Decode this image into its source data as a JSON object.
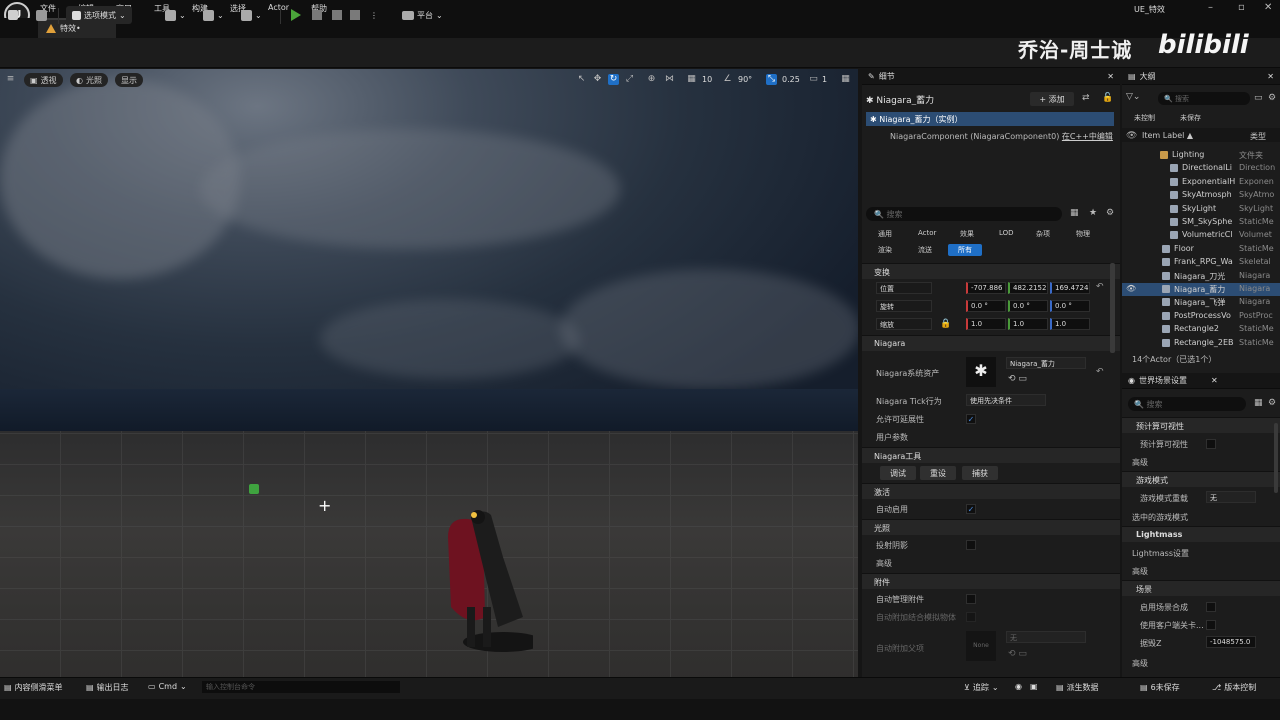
{
  "menu": {
    "items": [
      "文件",
      "编辑",
      "窗口",
      "工具",
      "构建",
      "选择",
      "Actor",
      "帮助"
    ],
    "window_title": "UE_特效"
  },
  "tab": {
    "label": "特效•"
  },
  "toolbar": {
    "mode": "选项模式",
    "platform": "平台"
  },
  "watermark": {
    "author": "乔治-周士诚",
    "site": "bilibili"
  },
  "viewport": {
    "perspective": "透视",
    "lit": "光照",
    "show": "显示",
    "grid_size": "10",
    "angle": "90°",
    "scale": "0.25",
    "camera_speed": "1"
  },
  "details": {
    "tab": "细节",
    "actor": "Niagara_蓄力",
    "add": "+ 添加",
    "instance": "Niagara_蓄力（实例）",
    "component": "NiagaraComponent (NiagaraComponent0)",
    "component_link": "在C++中编辑",
    "search_placeholder": "搜索",
    "cats_row1": [
      "通用",
      "Actor",
      "效果",
      "LOD",
      "杂项",
      "物理"
    ],
    "cats_row2": [
      "渲染",
      "流送",
      "所有"
    ],
    "sections": {
      "transform": "变换",
      "niagara": "Niagara",
      "tools": "Niagara工具",
      "activation": "激活",
      "lighting": "光照",
      "attachment": "附件"
    },
    "location": {
      "label": "位置",
      "x": "-707.886",
      "y": "482.2152",
      "z": "169.4724"
    },
    "rotation": {
      "label": "旋转",
      "x": "0.0 °",
      "y": "0.0 °",
      "z": "0.0 °"
    },
    "scale": {
      "label": "缩放",
      "x": "1.0",
      "y": "1.0",
      "z": "1.0"
    },
    "system_asset_label": "Niagara系统资产",
    "system_asset_value": "Niagara_蓄力",
    "tick_label": "Niagara Tick行为",
    "tick_value": "使用先决条件",
    "allow_scalability": "允许可延展性",
    "user_params": "用户参数",
    "tool_buttons": [
      "调试",
      "重设",
      "捕获"
    ],
    "auto_activate": "自动启用",
    "cast_shadow": "投射阴影",
    "advanced": "高级",
    "auto_manage": "自动管理附件",
    "auto_attach_weld": "自动附加结合模拟物体",
    "auto_attach_parent": "自动附加父项",
    "none": "None",
    "none2": "无"
  },
  "outliner": {
    "tab": "大纲",
    "search_placeholder": "搜索",
    "filter1": "未控制",
    "filter2": "未保存",
    "col_label": "Item Label ▲",
    "col_type": "类型",
    "items": [
      {
        "label": "Lighting",
        "type": "文件夹"
      },
      {
        "label": "DirectionalLi",
        "type": "Direction"
      },
      {
        "label": "ExponentialH",
        "type": "Exponen"
      },
      {
        "label": "SkyAtmosph",
        "type": "SkyAtmo"
      },
      {
        "label": "SkyLight",
        "type": "SkyLight"
      },
      {
        "label": "SM_SkySphe",
        "type": "StaticMe"
      },
      {
        "label": "VolumetricCl",
        "type": "Volumet"
      },
      {
        "label": "Floor",
        "type": "StaticMe"
      },
      {
        "label": "Frank_RPG_Wa",
        "type": "Skeletal"
      },
      {
        "label": "Niagara_刀光",
        "type": "Niagara"
      },
      {
        "label": "Niagara_蓄力",
        "type": "Niagara"
      },
      {
        "label": "Niagara_飞弹",
        "type": "Niagara"
      },
      {
        "label": "PostProcessVo",
        "type": "PostProc"
      },
      {
        "label": "Rectangle2",
        "type": "StaticMe"
      },
      {
        "label": "Rectangle_2EB",
        "type": "StaticMe"
      }
    ],
    "count": "14个Actor（已选1个）"
  },
  "world": {
    "tab": "世界场景设置",
    "search_placeholder": "搜索",
    "rows": [
      "预计算可视性",
      "预计算可视性",
      "高级",
      "游戏模式",
      "游戏模式重载",
      "选中的游戏模式",
      "Lightmass",
      "Lightmass设置",
      "高级",
      "场景",
      "启用场景合成",
      "使用客户端关卡...",
      "据毁Z",
      "高级"
    ],
    "gamemode_value": "无",
    "killz_value": "-1048575.0"
  },
  "status": {
    "content_drawer": "内容侧滑菜单",
    "output_log": "输出日志",
    "cmd": "Cmd",
    "cmd_placeholder": "输入控制台命令",
    "trace": "追踪",
    "derived": "派生数据",
    "unsaved": "6未保存",
    "source_control": "版本控制"
  }
}
